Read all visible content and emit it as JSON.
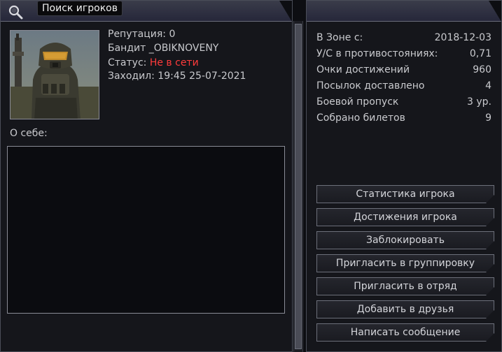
{
  "header": {
    "tooltip": "Поиск игроков"
  },
  "profile": {
    "reputation": "Репутация: 0",
    "name": "Бандит _OBIKNOVENY",
    "status_label": "Статус:",
    "status_value": "Не в сети",
    "last_seen": "Заходил: 19:45 25-07-2021",
    "about_label": "О себе:",
    "about_text": ""
  },
  "stats": [
    {
      "label": "В Зоне с:",
      "value": "2018-12-03"
    },
    {
      "label": "У/С в противостояниях:",
      "value": "0,71"
    },
    {
      "label": "Очки достижений",
      "value": "960"
    },
    {
      "label": "Посылок доставлено",
      "value": "4"
    },
    {
      "label": "Боевой пропуск",
      "value": "3 ур."
    },
    {
      "label": "Собрано билетов",
      "value": "9"
    }
  ],
  "actions": [
    {
      "label": "Статистика игрока"
    },
    {
      "label": "Достижения игрока"
    },
    {
      "label": "Заблокировать"
    },
    {
      "label": "Пригласить в группировку"
    },
    {
      "label": "Пригласить в отряд"
    },
    {
      "label": "Добавить в друзья"
    },
    {
      "label": "Написать сообщение"
    }
  ],
  "colors": {
    "status_offline": "#ff3b3b",
    "panel_bg": "#15161b",
    "border": "#8a8c96"
  }
}
